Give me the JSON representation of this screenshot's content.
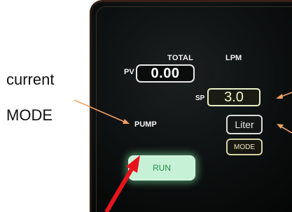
{
  "screen": {
    "total_label": "TOTAL",
    "unit_label": "LPM",
    "pv_label": "PV",
    "pv_value": "0.00",
    "sp_label": "SP",
    "sp_value": "3.0",
    "pump_label": "PUMP",
    "run_button": "RUN",
    "liter_button": "Liter",
    "mode_button": "MODE"
  },
  "annotation": {
    "line1": "current",
    "line2": "MODE"
  },
  "colors": {
    "screen_bg": "#0d1010",
    "run_fill": "#c7f1d6",
    "run_text": "#248f4b",
    "sp_text": "#f3f6c9",
    "callout_orange": "#f0a060",
    "callout_red": "#e8141c"
  }
}
